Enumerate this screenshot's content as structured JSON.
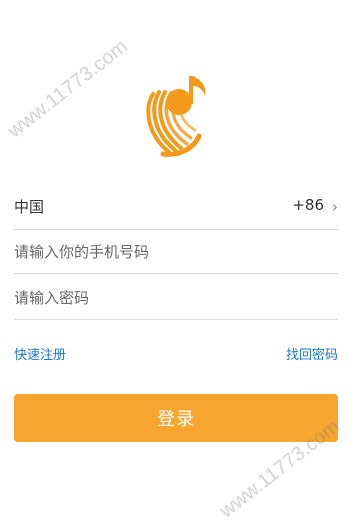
{
  "logo": {
    "icon": "music-note-logo",
    "colors": {
      "primary": "#f39a1c",
      "accent": "#f6a52e"
    }
  },
  "form": {
    "country": {
      "name": "中国",
      "code": "+86",
      "chevron": "›"
    },
    "phone": {
      "placeholder": "请输入你的手机号码",
      "value": ""
    },
    "password": {
      "placeholder": "请输入密码",
      "value": ""
    }
  },
  "links": {
    "register": "快速注册",
    "forgot": "找回密码"
  },
  "login_button": {
    "label": "登录",
    "color": "#f6a52e"
  },
  "watermark": {
    "text": "www.11773.com"
  }
}
